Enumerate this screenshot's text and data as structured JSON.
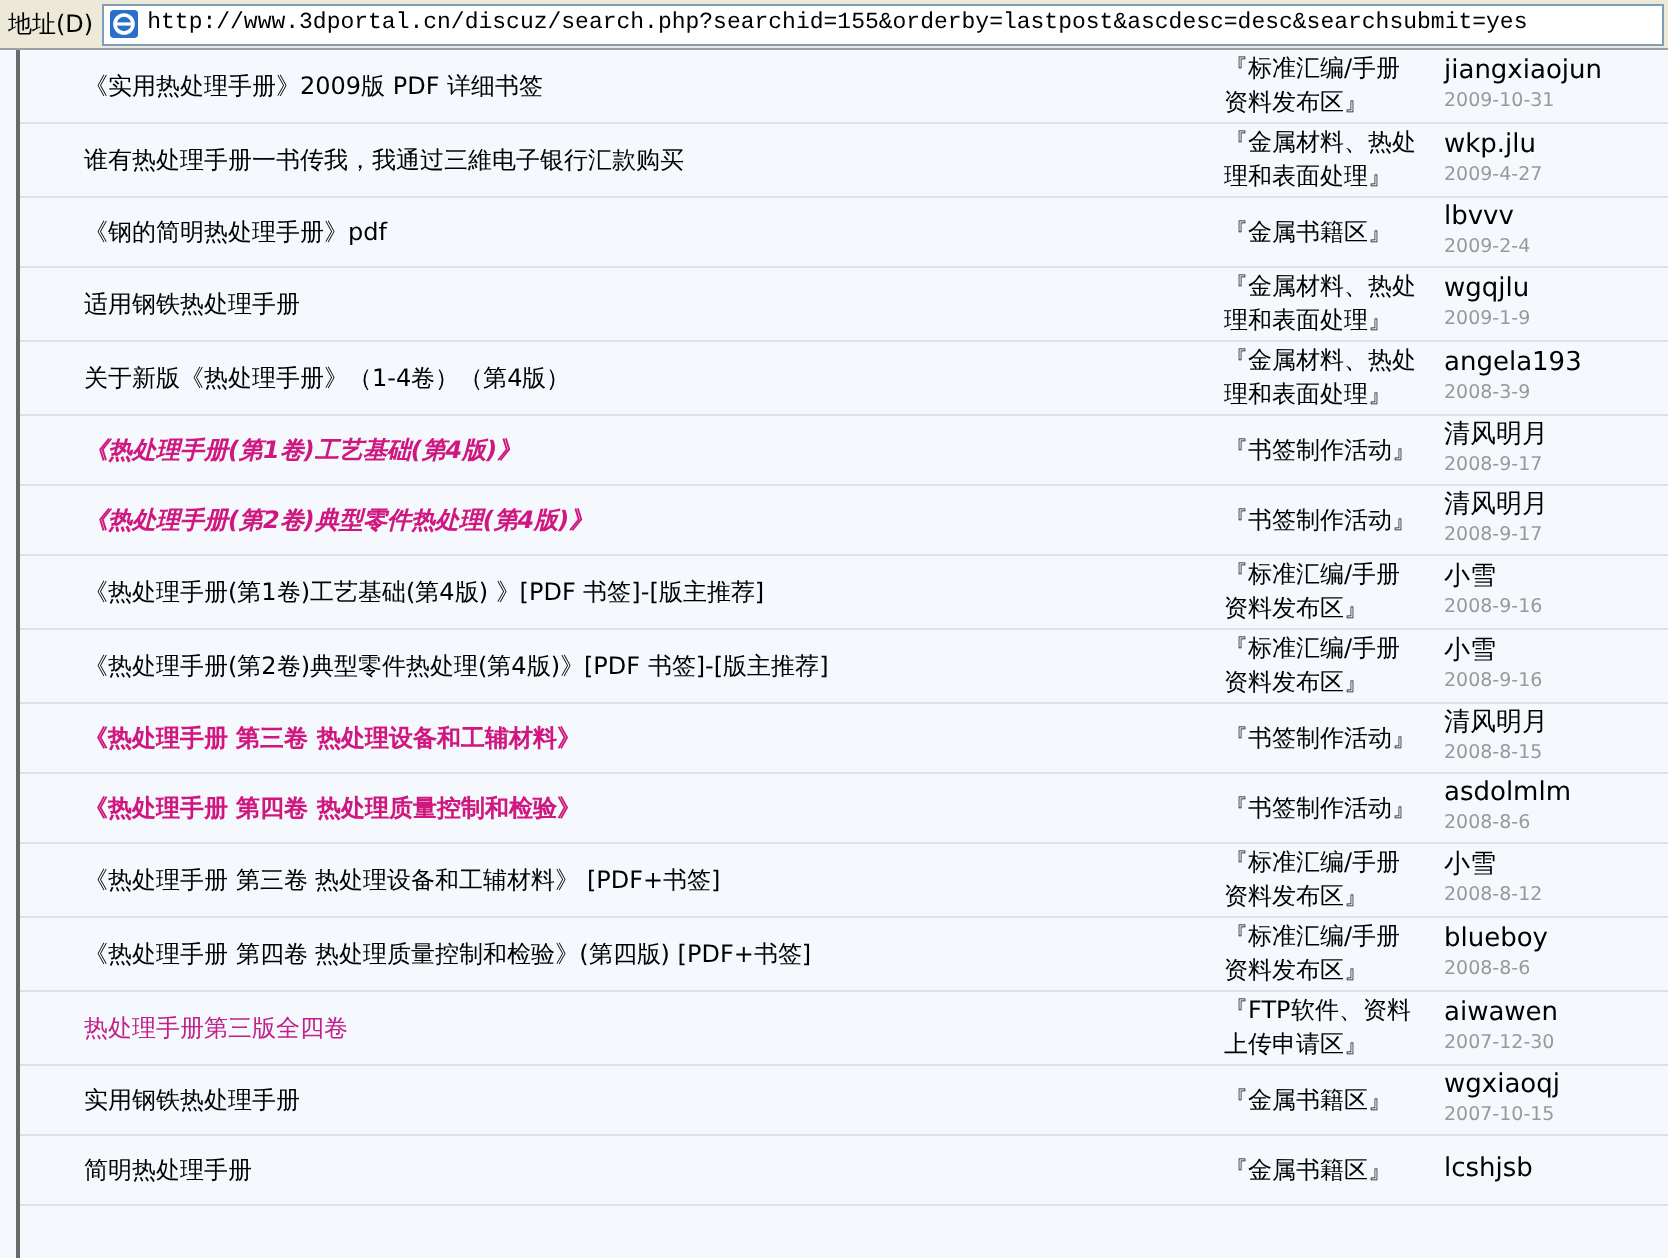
{
  "address_bar": {
    "label": "地址(D)",
    "url": "http://www.3dportal.cn/discuz/search.php?searchid=155&orderby=lastpost&ascdesc=desc&searchsubmit=yes"
  },
  "rows": [
    {
      "title": "《实用热处理手册》2009版  PDF 详细书签",
      "kind": "normal",
      "forum": "『标准汇编/手册资料发布区』",
      "author": "jiangxiaojun",
      "date": "2009-10-31"
    },
    {
      "title": "谁有热处理手册一书传我，我通过三維电子银行汇款购买",
      "kind": "normal",
      "forum": "『金属材料、热处理和表面处理』",
      "author": "wkp.jlu",
      "date": "2009-4-27"
    },
    {
      "title": "《钢的简明热处理手册》pdf",
      "kind": "normal",
      "forum": "『金属书籍区』",
      "author": "lbvvv",
      "date": "2009-2-4"
    },
    {
      "title": "适用钢铁热处理手册",
      "kind": "normal",
      "forum": "『金属材料、热处理和表面处理』",
      "author": "wgqjlu",
      "date": "2009-1-9"
    },
    {
      "title": "关于新版《热处理手册》（1-4卷）（第4版）",
      "kind": "normal",
      "forum": "『金属材料、热处理和表面处理』",
      "author": "angela193",
      "date": "2008-3-9"
    },
    {
      "title": "《热处理手册(第1卷)工艺基础(第4版)》",
      "kind": "pink_italic",
      "forum": "『书签制作活动』",
      "author": "清风明月",
      "date": "2008-9-17"
    },
    {
      "title": "《热处理手册(第2卷)典型零件热处理(第4版)》",
      "kind": "pink_italic",
      "forum": "『书签制作活动』",
      "author": "清风明月",
      "date": "2008-9-17"
    },
    {
      "title": "《热处理手册(第1卷)工艺基础(第4版) 》[PDF 书签]-[版主推荐]",
      "kind": "normal",
      "forum": "『标准汇编/手册资料发布区』",
      "author": "小雪",
      "date": "2008-9-16"
    },
    {
      "title": "《热处理手册(第2卷)典型零件热处理(第4版)》[PDF 书签]-[版主推荐]",
      "kind": "normal",
      "forum": "『标准汇编/手册资料发布区』",
      "author": "小雪",
      "date": "2008-9-16"
    },
    {
      "title": "《热处理手册  第三卷  热处理设备和工辅材料》",
      "kind": "pink_bold",
      "forum": "『书签制作活动』",
      "author": "清风明月",
      "date": "2008-8-15"
    },
    {
      "title": "《热处理手册  第四卷  热处理质量控制和检验》",
      "kind": "pink_bold",
      "forum": "『书签制作活动』",
      "author": "asdolmlm",
      "date": "2008-8-6"
    },
    {
      "title": "《热处理手册  第三卷  热处理设备和工辅材料》  [PDF+书签]",
      "kind": "normal",
      "forum": "『标准汇编/手册资料发布区』",
      "author": "小雪",
      "date": "2008-8-12"
    },
    {
      "title": "《热处理手册  第四卷  热处理质量控制和检验》(第四版) [PDF+书签]",
      "kind": "normal",
      "forum": "『标准汇编/手册资料发布区』",
      "author": "blueboy",
      "date": "2008-8-6"
    },
    {
      "title": "热处理手册第三版全四卷",
      "kind": "pink",
      "forum": "『FTP软件、资料上传申请区』",
      "author": "aiwawen",
      "date": "2007-12-30"
    },
    {
      "title": "实用钢铁热处理手册",
      "kind": "normal",
      "forum": "『金属书籍区』",
      "author": "wgxiaoqj",
      "date": "2007-10-15"
    },
    {
      "title": "简明热处理手册",
      "kind": "normal",
      "forum": "『金属书籍区』",
      "author": "lcshjsb"
    }
  ]
}
